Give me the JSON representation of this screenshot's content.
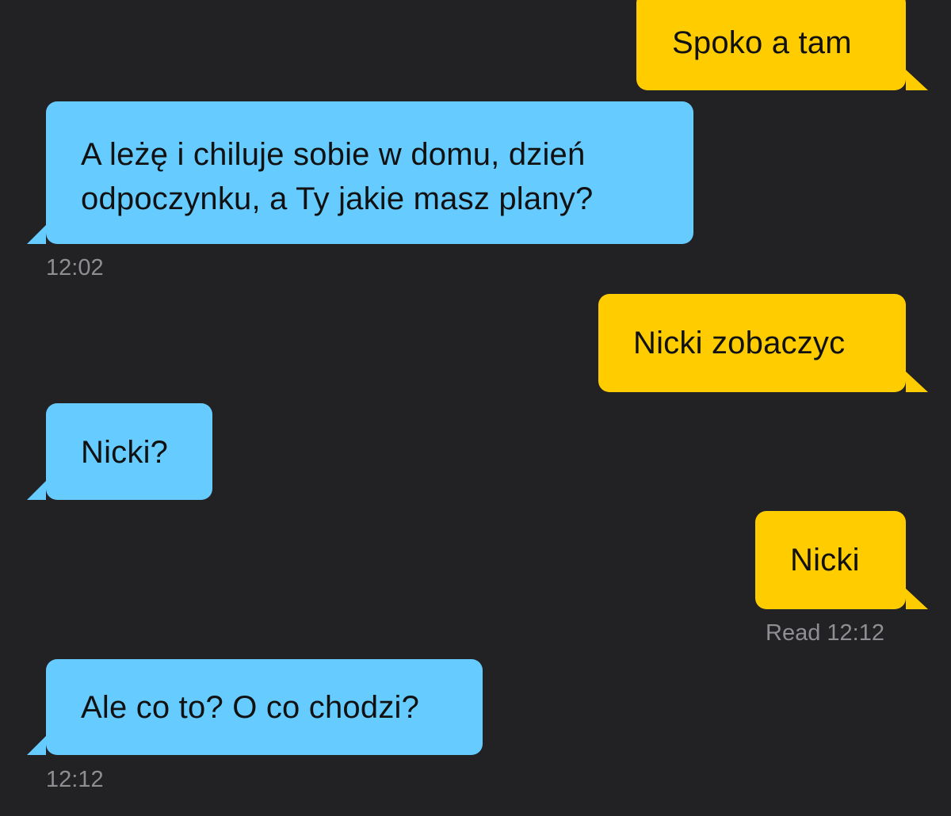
{
  "colors": {
    "background": "#222124",
    "sent_bubble": "#FFCC00",
    "received_bubble": "#66CCFF",
    "message_text": "#111111",
    "timestamp_text": "#8E8E93"
  },
  "messages": [
    {
      "direction": "sent",
      "text": "Spoko a tam"
    },
    {
      "direction": "received",
      "lines": [
        "A leżę i chiluje sobie w domu, dzień",
        "odpoczynku, a Ty jakie masz plany?"
      ],
      "time": "12:02"
    },
    {
      "direction": "sent",
      "text": "Nicki zobaczyc"
    },
    {
      "direction": "received",
      "text": "Nicki?"
    },
    {
      "direction": "sent",
      "text": "Nicki",
      "status": "Read 12:12"
    },
    {
      "direction": "received",
      "text": "Ale co to? O co chodzi?",
      "time": "12:12"
    }
  ]
}
